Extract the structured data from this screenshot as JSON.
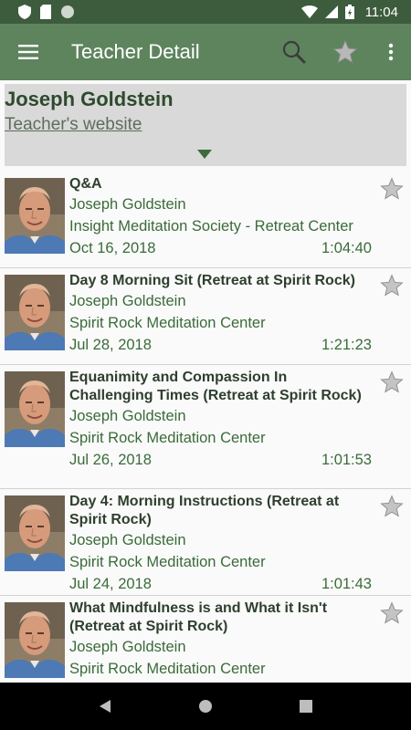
{
  "status": {
    "time": "11:04"
  },
  "appbar": {
    "title": "Teacher Detail"
  },
  "teacher": {
    "name": "Joseph Goldstein",
    "website_label": "Teacher's website"
  },
  "talks": [
    {
      "title": "Q&A",
      "teacher": "Joseph Goldstein",
      "venue": "Insight Meditation Society - Retreat Center",
      "date": "Oct 16, 2018",
      "duration": "1:04:40"
    },
    {
      "title": "Day 8 Morning Sit (Retreat at Spirit Rock)",
      "teacher": "Joseph Goldstein",
      "venue": "Spirit Rock Meditation Center",
      "date": "Jul 28, 2018",
      "duration": "1:21:23"
    },
    {
      "title": "Equanimity and Compassion In Challenging Times (Retreat at Spirit Rock)",
      "teacher": "Joseph Goldstein",
      "venue": "Spirit Rock Meditation Center",
      "date": "Jul 26, 2018",
      "duration": "1:01:53"
    },
    {
      "title": "Day 4: Morning Instructions (Retreat at Spirit Rock)",
      "teacher": "Joseph Goldstein",
      "venue": "Spirit Rock Meditation Center",
      "date": "Jul 24, 2018",
      "duration": "1:01:43"
    },
    {
      "title": "What Mindfulness is and What it Isn't (Retreat at Spirit Rock)",
      "teacher": "Joseph Goldstein",
      "venue": "Spirit Rock Meditation Center",
      "date": "",
      "duration": ""
    }
  ],
  "colors": {
    "status_bar": "#3d5b3d",
    "app_bar": "#5e845e",
    "header_bg": "#d9d9d9",
    "text_green": "#3a6b3a"
  }
}
